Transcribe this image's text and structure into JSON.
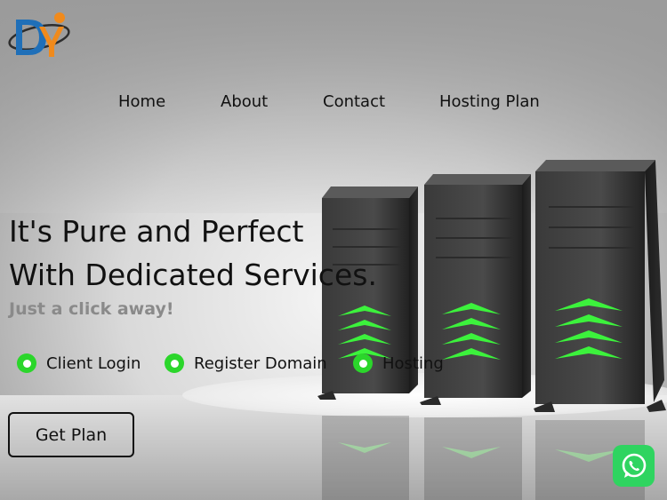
{
  "nav": {
    "items": [
      {
        "label": "Home"
      },
      {
        "label": "About"
      },
      {
        "label": "Contact"
      },
      {
        "label": "Hosting Plan"
      }
    ]
  },
  "hero": {
    "title_line1": "It's Pure and Perfect",
    "title_line2": "With Dedicated Services.",
    "subtitle": "Just a click away!"
  },
  "features": [
    {
      "label": "Client Login"
    },
    {
      "label": "Register Domain"
    },
    {
      "label": "Hosting"
    }
  ],
  "cta": {
    "label": "Get Plan"
  },
  "colors": {
    "accent_green": "#2bd62b",
    "whatsapp_green": "#2fd460",
    "logo_blue": "#1f6fb8",
    "logo_orange": "#f08a1c"
  },
  "icons": {
    "logo": "dy-logo",
    "feature_bullet": "green-dot-icon",
    "chat": "whatsapp-icon"
  }
}
